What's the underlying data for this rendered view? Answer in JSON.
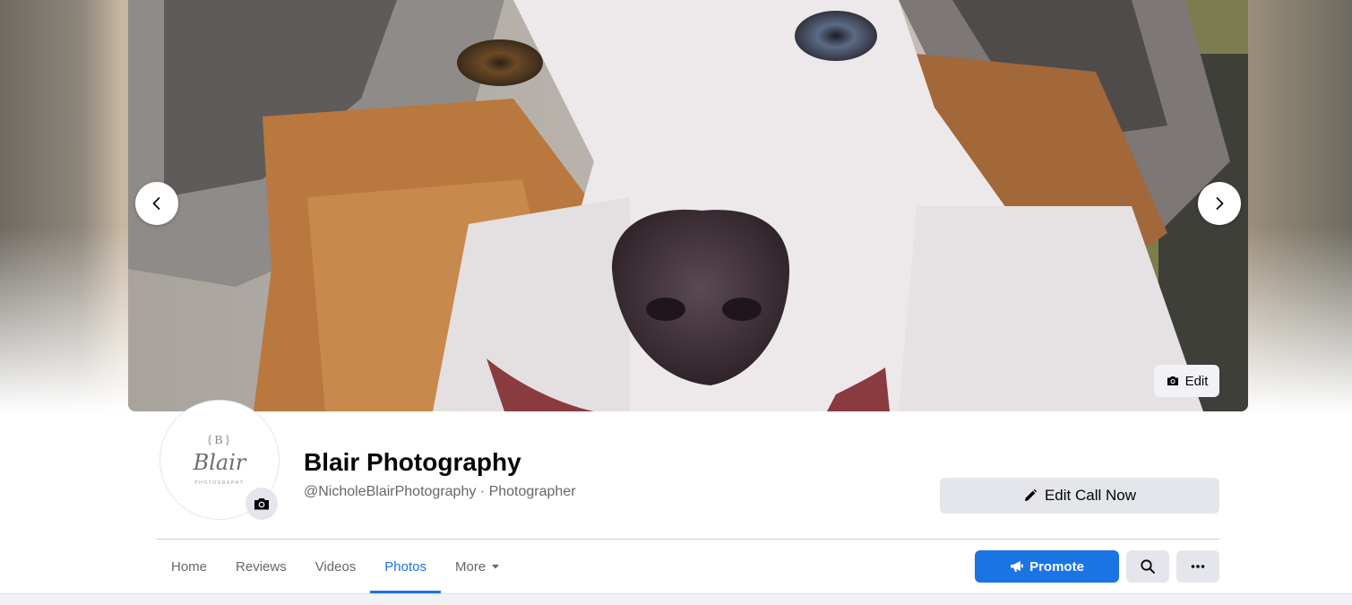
{
  "cover": {
    "edit_label": "Edit"
  },
  "profile": {
    "logo": {
      "monogram": "{B}",
      "name": "Blair",
      "sub": "PHOTOGRAPHY"
    },
    "name": "Blair Photography",
    "subtitle": "@NicholeBlairPhotography · Photographer"
  },
  "actions": {
    "edit_call_label": "Edit Call Now",
    "promote_label": "Promote"
  },
  "tabs": [
    {
      "label": "Home",
      "active": false
    },
    {
      "label": "Reviews",
      "active": false
    },
    {
      "label": "Videos",
      "active": false
    },
    {
      "label": "Photos",
      "active": true
    },
    {
      "label": "More",
      "active": false
    }
  ],
  "icons": {
    "prev": "chevron-left-icon",
    "next": "chevron-right-icon",
    "camera": "camera-icon",
    "pencil": "pencil-icon",
    "megaphone": "megaphone-icon",
    "search": "search-icon",
    "ellipsis": "ellipsis-icon",
    "caret": "caret-down-icon"
  },
  "colors": {
    "accent": "#1b74e4",
    "button_gray": "#e4e6eb",
    "text_primary": "#050505",
    "text_secondary": "#65676b"
  }
}
